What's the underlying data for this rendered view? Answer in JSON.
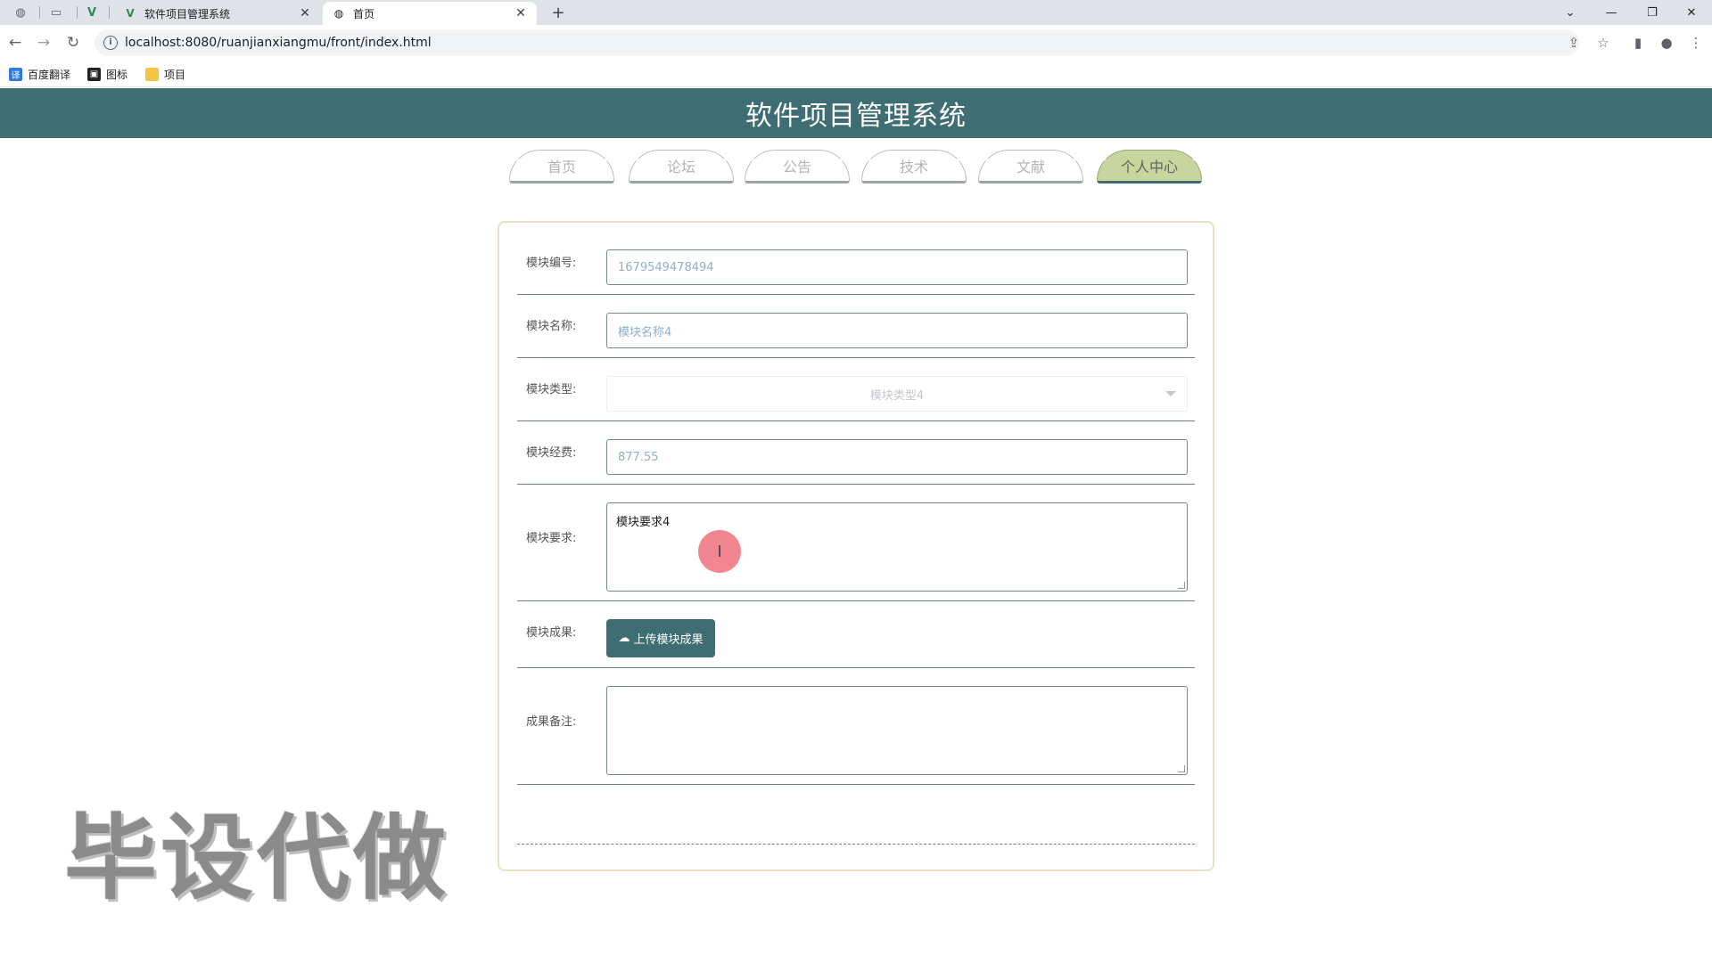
{
  "browser": {
    "tabs": [
      {
        "label": "软件项目管理系统",
        "active": false
      },
      {
        "label": "首页",
        "active": true
      }
    ],
    "url": "localhost:8080/ruanjianxiangmu/front/index.html",
    "bookmarks": [
      "百度翻译",
      "图标",
      "项目"
    ]
  },
  "header": {
    "title": "软件项目管理系统"
  },
  "nav": {
    "items": [
      "首页",
      "论坛",
      "公告",
      "技术",
      "文献",
      "个人中心"
    ],
    "active_index": 5
  },
  "form": {
    "module_no": {
      "label": "模块编号:",
      "value": "1679549478494"
    },
    "module_name": {
      "label": "模块名称:",
      "value": "模块名称4"
    },
    "module_type": {
      "label": "模块类型:",
      "value": "模块类型4"
    },
    "module_fee": {
      "label": "模块经费:",
      "value": "877.55"
    },
    "module_req": {
      "label": "模块要求:",
      "value": "模块要求4"
    },
    "module_result": {
      "label": "模块成果:",
      "button": "上传模块成果"
    },
    "result_note": {
      "label": "成果备注:",
      "value": ""
    }
  },
  "watermark": "毕设代做",
  "colors": {
    "header": "#3e6e73",
    "nav_active": "#c9d49e",
    "button": "#3e6e73"
  }
}
